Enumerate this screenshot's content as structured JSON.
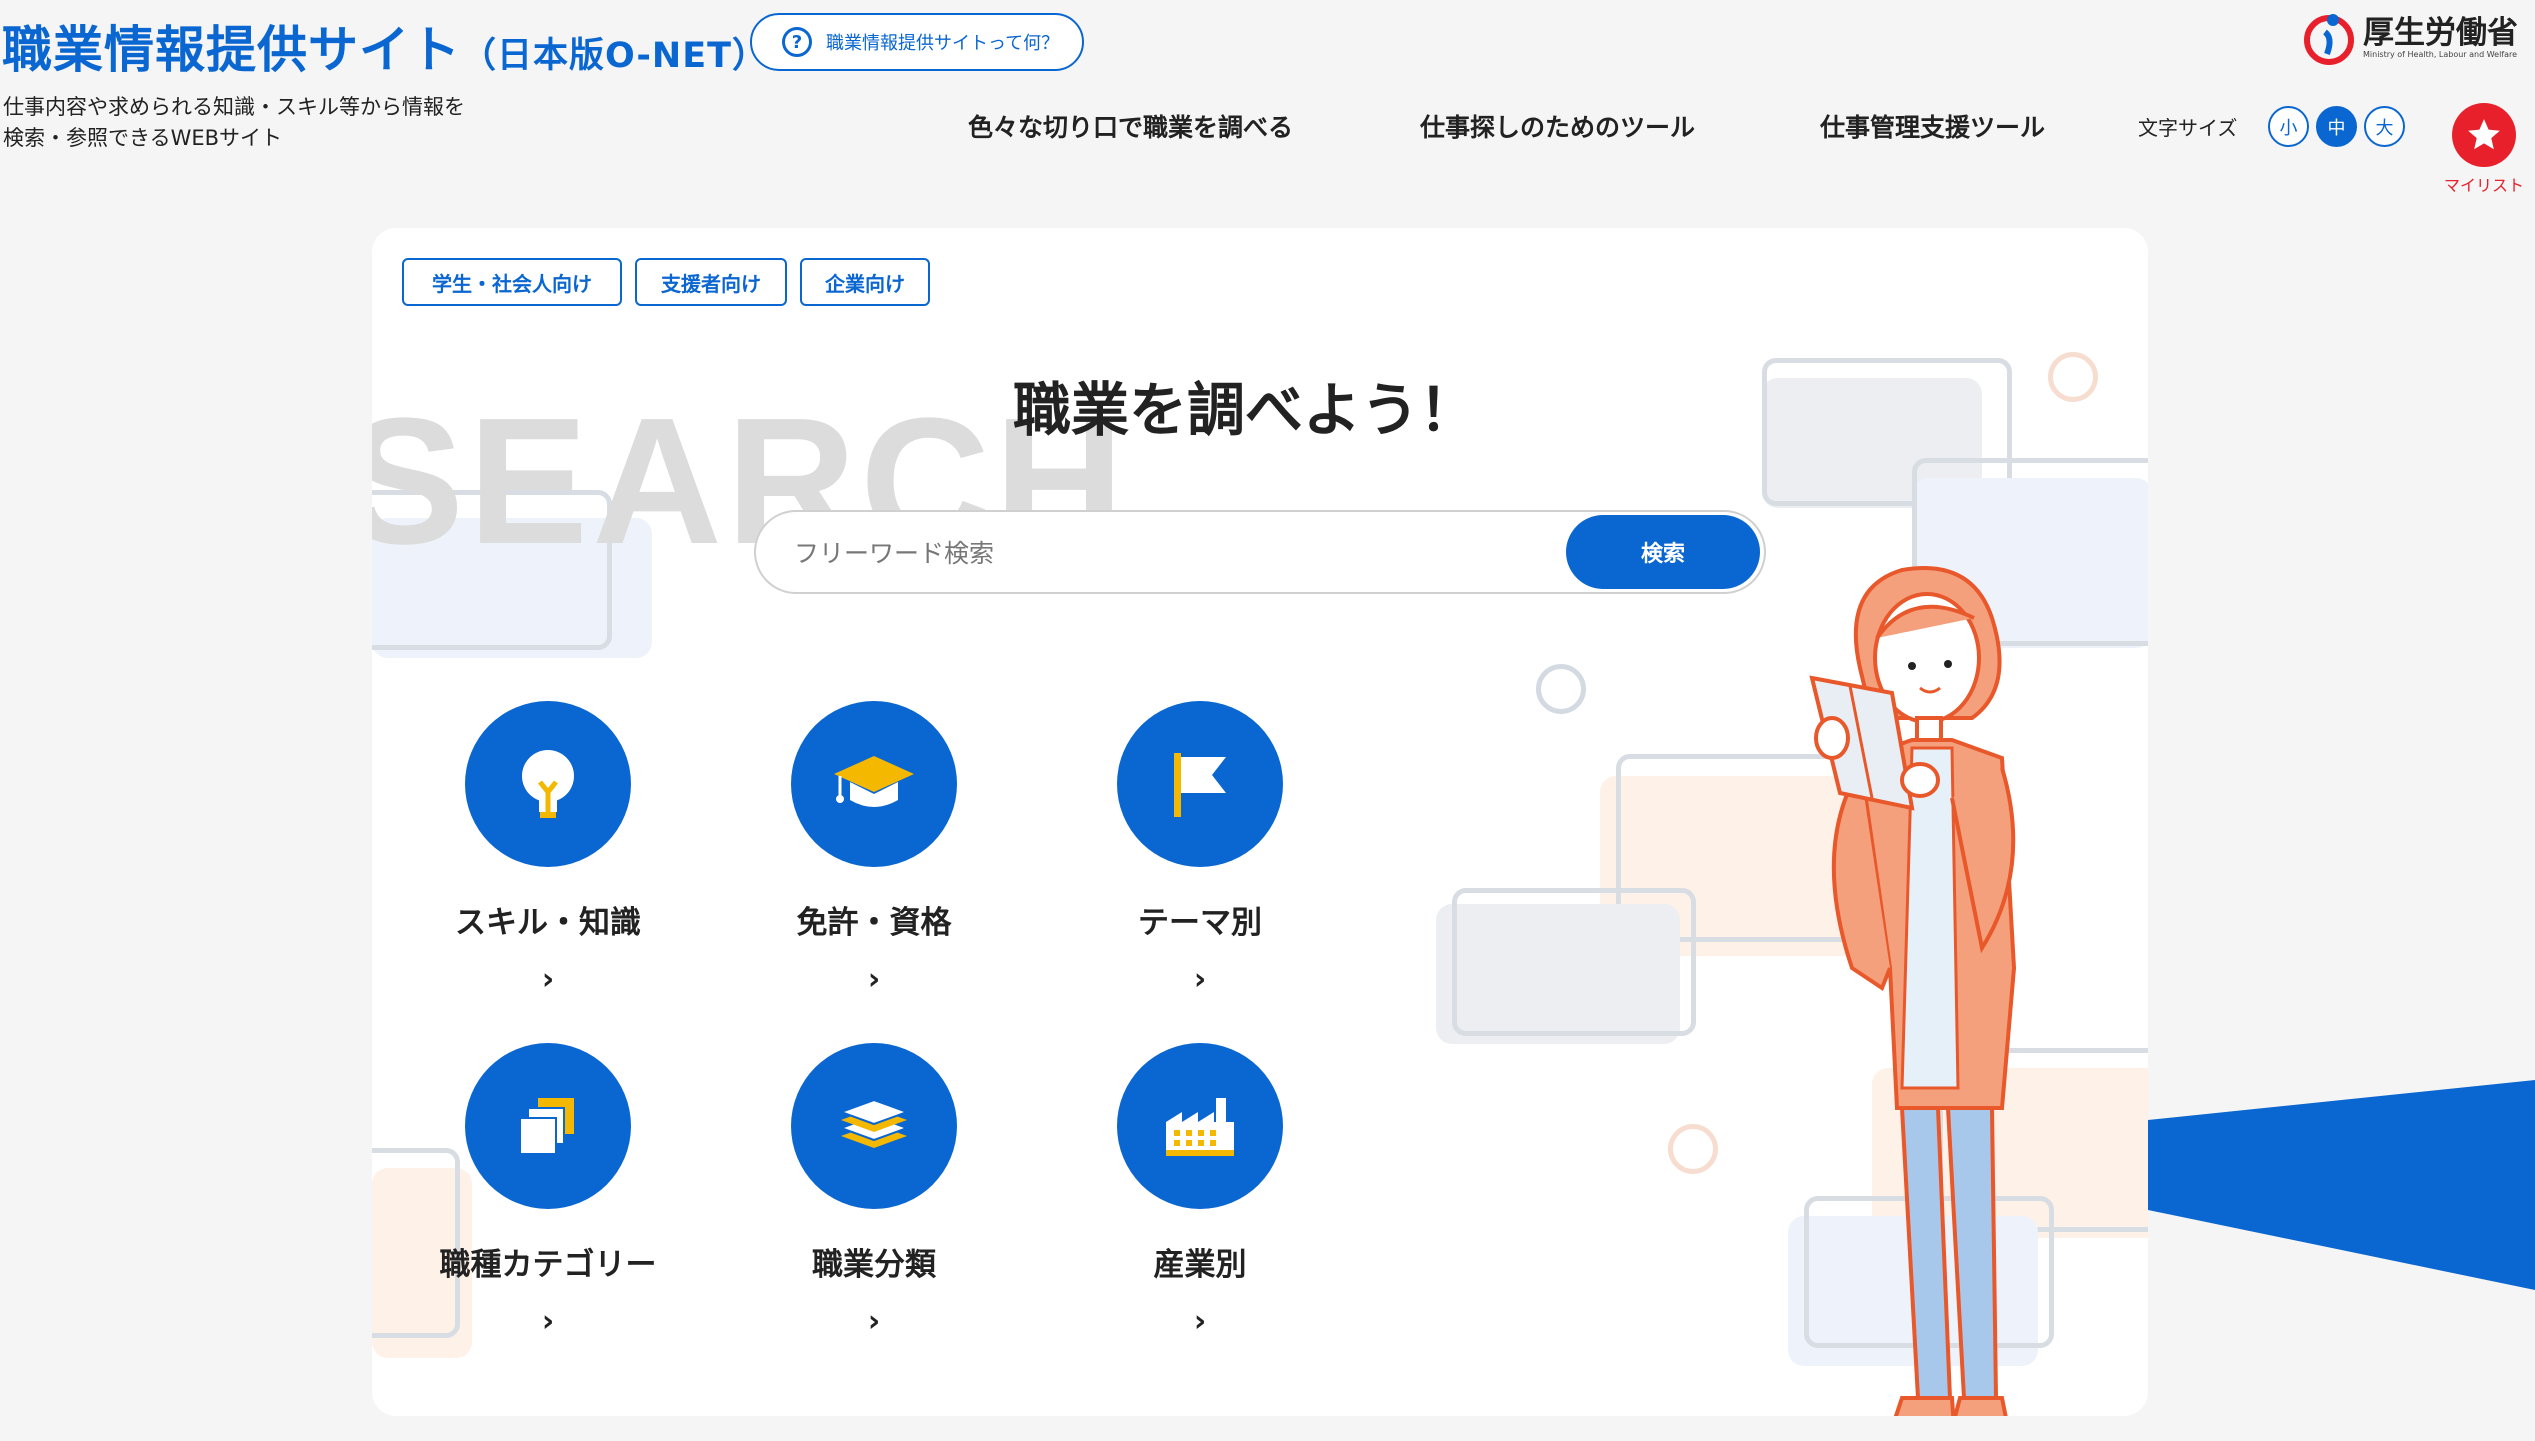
{
  "header": {
    "title": "職業情報提供サイト",
    "title_sub": "（日本版O-NET）",
    "about_button": "職業情報提供サイトって何？",
    "tagline_line1": "仕事内容や求められる知識・スキル等から情報を",
    "tagline_line2": "検索・参照できるWEBサイト",
    "nav": [
      "色々な切り口で職業を調べる",
      "仕事探しのためのツール",
      "仕事管理支援ツール"
    ],
    "font_size_label": "文字サイズ",
    "font_sizes": [
      "小",
      "中",
      "大"
    ],
    "mylist_label": "マイリスト",
    "ministry_name": "厚生労働省",
    "ministry_sub": "Ministry of Health, Labour and Welfare"
  },
  "main": {
    "audience_buttons": [
      "学生・社会人向け",
      "支援者向け",
      "企業向け"
    ],
    "watermark": "SEARCH",
    "hero_title": "職業を調べよう！",
    "search": {
      "placeholder": "フリーワード検索",
      "value": "",
      "button": "検索"
    },
    "categories": [
      {
        "label": "スキル・知識",
        "icon": "lightbulb-icon"
      },
      {
        "label": "免許・資格",
        "icon": "graduation-cap-icon"
      },
      {
        "label": "テーマ別",
        "icon": "flag-icon"
      },
      {
        "label": "職種カテゴリー",
        "icon": "category-squares-icon"
      },
      {
        "label": "職業分類",
        "icon": "stacked-layers-icon"
      },
      {
        "label": "産業別",
        "icon": "factory-icon"
      }
    ],
    "chevron": "›"
  },
  "colors": {
    "primary": "#0a66d0",
    "accent_red": "#e8202b",
    "illustration_orange": "#f4a07c"
  }
}
